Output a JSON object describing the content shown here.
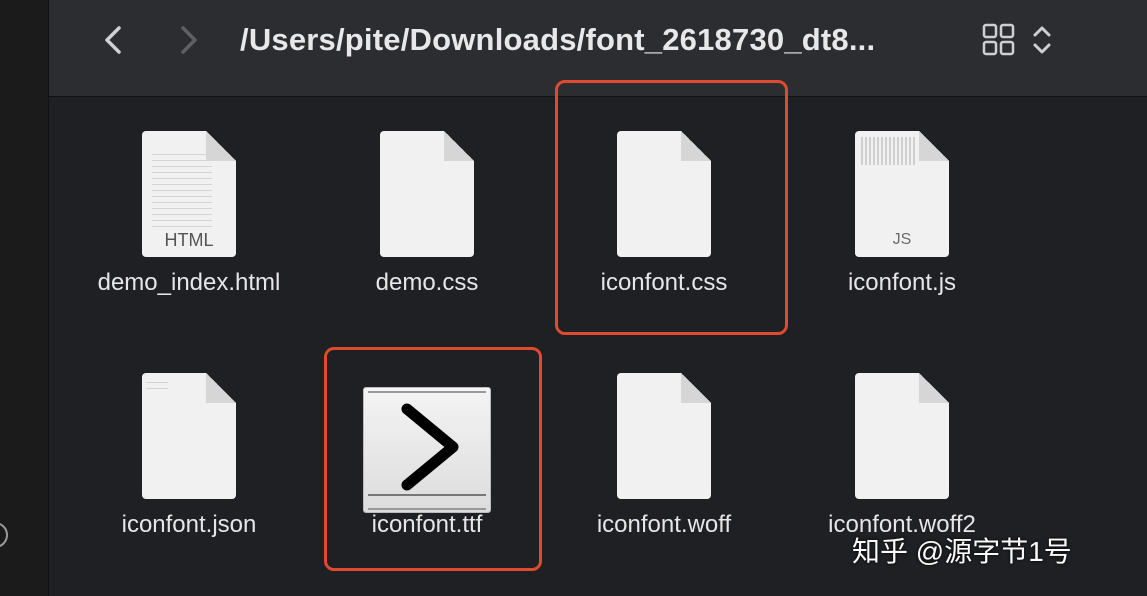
{
  "toolbar": {
    "back_icon": "chevron-left-icon",
    "forward_icon": "chevron-right-icon",
    "path": "/Users/pite/Downloads/font_2618730_dt8...",
    "view_icon": "grid-view-icon",
    "sort_icon": "up-down-chevron-icon"
  },
  "files": [
    {
      "name": "demo_index.html",
      "badge": "HTML"
    },
    {
      "name": "demo.css",
      "badge": ""
    },
    {
      "name": "iconfont.css",
      "badge": ""
    },
    {
      "name": "iconfont.js",
      "badge": "JS"
    },
    {
      "name": "iconfont.json",
      "badge": ""
    },
    {
      "name": "iconfont.ttf",
      "badge": ""
    },
    {
      "name": "iconfont.woff",
      "badge": ""
    },
    {
      "name": "iconfont.woff2",
      "badge": ""
    }
  ],
  "highlight_color": "#e04a2e",
  "watermark": "知乎 @源字节1号"
}
